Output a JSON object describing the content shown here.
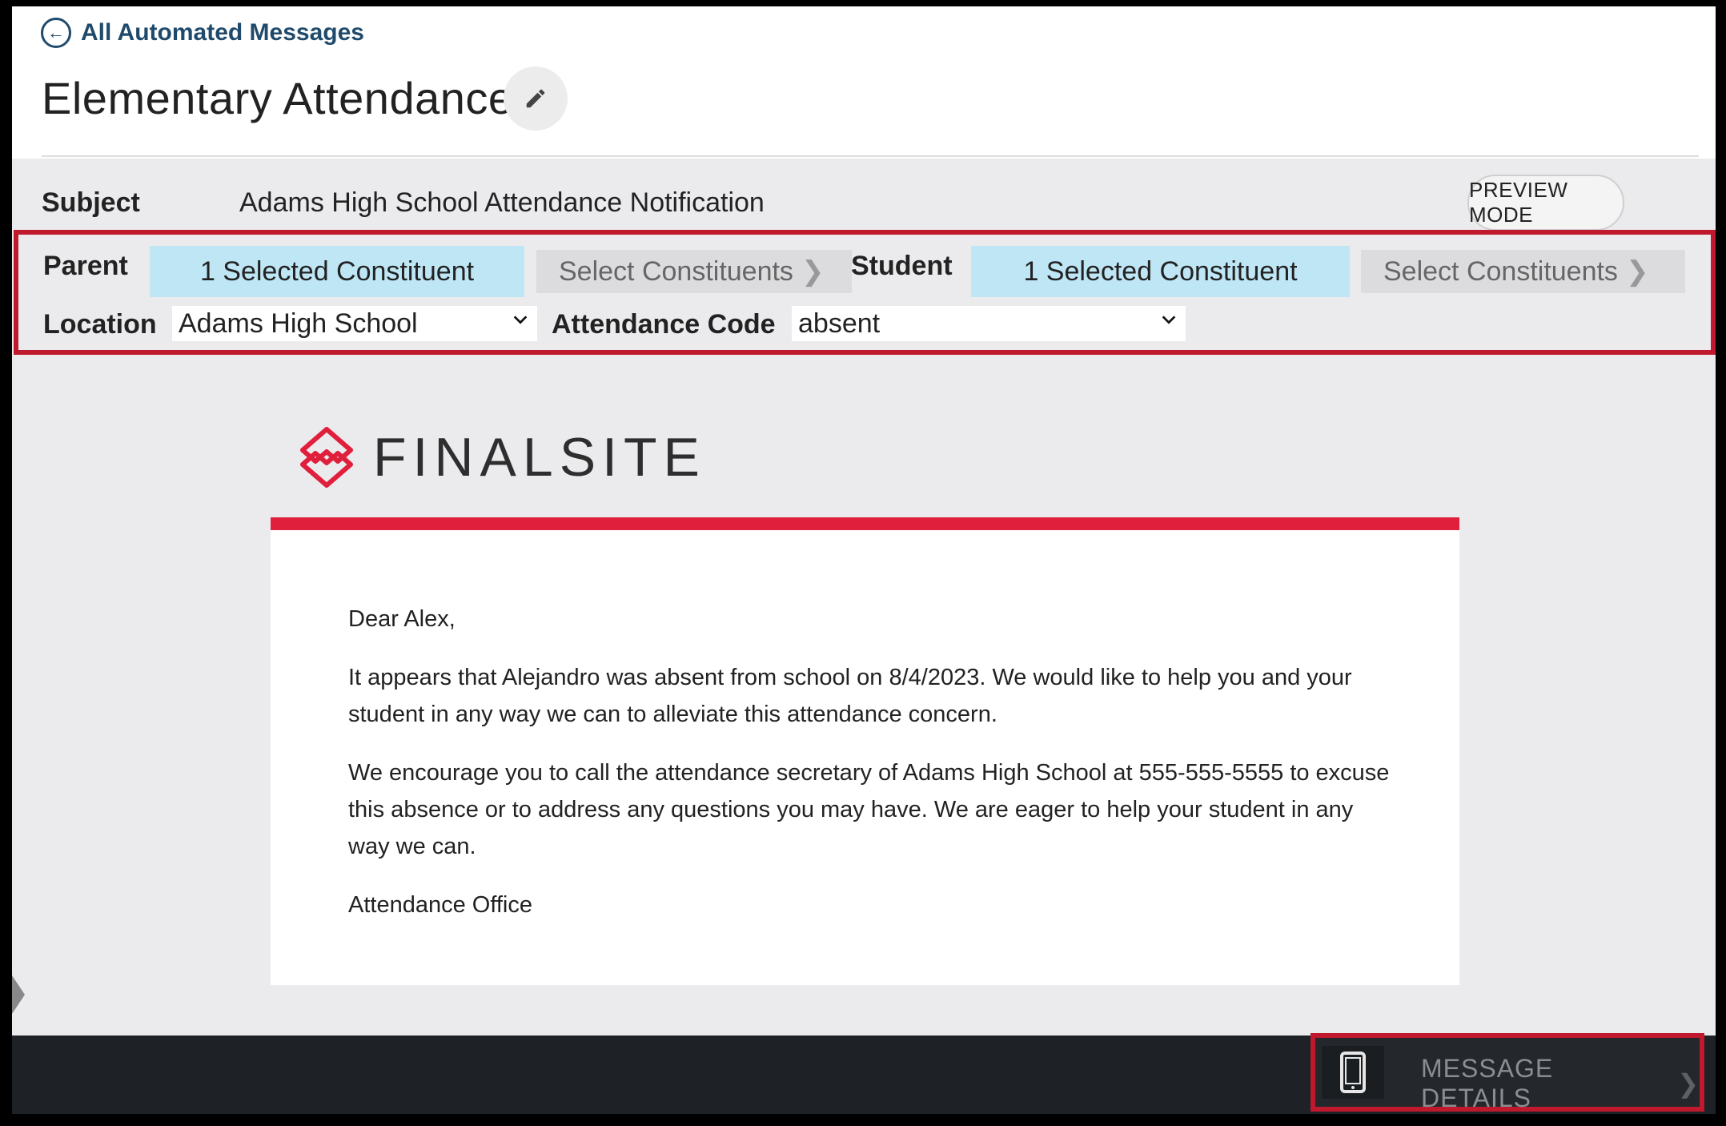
{
  "header": {
    "back_link": "All Automated Messages",
    "title": "Elementary Attendance"
  },
  "subject": {
    "label": "Subject",
    "value": "Adams High School Attendance Notification",
    "preview_button": "PREVIEW MODE"
  },
  "filters": {
    "parent_label": "Parent",
    "parent_selected": "1 Selected Constituent",
    "parent_select": "Select Constituents",
    "student_label": "Student",
    "student_selected": "1 Selected Constituent",
    "student_select": "Select Constituents",
    "location_label": "Location",
    "location_value": "Adams High School",
    "attendance_label": "Attendance Code",
    "attendance_value": "absent"
  },
  "email": {
    "logo_text": "FINALSITE",
    "greeting": "Dear Alex,",
    "paragraph1": "It appears that Alejandro was absent from school on 8/4/2023.  We would like to help you and your student in any way we can to alleviate this attendance concern.",
    "paragraph2": "We encourage you to call the attendance secretary of Adams High School at 555-555-5555 to excuse this absence or to address any questions you may have.  We are eager to help your student in any way we can.",
    "signature": "Attendance Office"
  },
  "footer": {
    "details_label": "MESSAGE DETAILS"
  },
  "colors": {
    "accent_red": "#e01f3d",
    "highlight_border": "#c0182c",
    "selected_chip": "#bfe6f5",
    "link_blue": "#1f4a6b"
  },
  "icons": [
    "back-arrow-circle-icon",
    "pencil-icon",
    "chevron-right-icon",
    "chevron-down-icon",
    "finalsite-logo-icon",
    "mobile-phone-icon"
  ]
}
